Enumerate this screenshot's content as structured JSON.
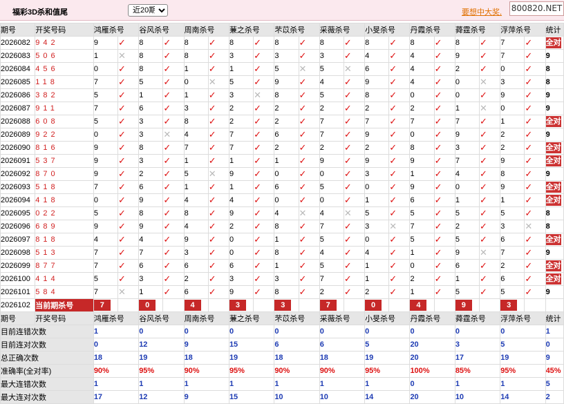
{
  "header": {
    "title": "福彩3D杀和值尾",
    "period_selected": "近20期",
    "period_options": [
      "近20期"
    ],
    "promo_link": "要想中大奖,",
    "site": "800820.NET"
  },
  "columns": {
    "issue": "期号",
    "draw": "开奖号码",
    "experts": [
      "鸿雁杀号",
      "谷风杀号",
      "周南杀号",
      "蒹之杀号",
      "芣苡杀号",
      "采薇杀号",
      "小旻杀号",
      "丹霞杀号",
      "蕣霆杀号",
      "浮萍杀号"
    ],
    "stats": "统计"
  },
  "rows": [
    {
      "issue": "2026082",
      "draw": "942",
      "v": [
        "9",
        "8",
        "8",
        "8",
        "8",
        "8",
        "8",
        "8",
        "8",
        "7"
      ],
      "m": [
        1,
        1,
        1,
        1,
        1,
        1,
        1,
        1,
        1,
        1
      ],
      "stat": "全对"
    },
    {
      "issue": "2026083",
      "draw": "506",
      "v": [
        "1",
        "8",
        "8",
        "3",
        "3",
        "3",
        "4",
        "4",
        "9",
        "7"
      ],
      "m": [
        0,
        1,
        1,
        1,
        1,
        1,
        1,
        1,
        1,
        1
      ],
      "stat": "9"
    },
    {
      "issue": "2026084",
      "draw": "456",
      "v": [
        "0",
        "8",
        "1",
        "1",
        "5",
        "5",
        "6",
        "4",
        "2",
        "0"
      ],
      "m": [
        1,
        1,
        1,
        1,
        0,
        0,
        1,
        1,
        1,
        1
      ],
      "stat": "8"
    },
    {
      "issue": "2026085",
      "draw": "118",
      "v": [
        "7",
        "5",
        "0",
        "5",
        "9",
        "4",
        "9",
        "4",
        "0",
        "3"
      ],
      "m": [
        1,
        1,
        0,
        1,
        1,
        1,
        1,
        1,
        0,
        1
      ],
      "stat": "8"
    },
    {
      "issue": "2026086",
      "draw": "382",
      "v": [
        "5",
        "1",
        "1",
        "3",
        "8",
        "5",
        "8",
        "0",
        "0",
        "9"
      ],
      "m": [
        1,
        1,
        1,
        0,
        1,
        1,
        1,
        1,
        1,
        1
      ],
      "stat": "9"
    },
    {
      "issue": "2026087",
      "draw": "911",
      "v": [
        "7",
        "6",
        "3",
        "2",
        "2",
        "2",
        "2",
        "2",
        "1",
        "0"
      ],
      "m": [
        1,
        1,
        1,
        1,
        1,
        1,
        1,
        1,
        0,
        1
      ],
      "stat": "9"
    },
    {
      "issue": "2026088",
      "draw": "608",
      "v": [
        "5",
        "3",
        "8",
        "2",
        "2",
        "7",
        "7",
        "7",
        "7",
        "1"
      ],
      "m": [
        1,
        1,
        1,
        1,
        1,
        1,
        1,
        1,
        1,
        1
      ],
      "stat": "全对"
    },
    {
      "issue": "2026089",
      "draw": "922",
      "v": [
        "0",
        "3",
        "4",
        "7",
        "6",
        "7",
        "9",
        "0",
        "9",
        "2"
      ],
      "m": [
        1,
        0,
        1,
        1,
        1,
        1,
        1,
        1,
        1,
        1
      ],
      "stat": "9"
    },
    {
      "issue": "2026090",
      "draw": "816",
      "v": [
        "9",
        "8",
        "7",
        "7",
        "2",
        "2",
        "2",
        "8",
        "3",
        "2"
      ],
      "m": [
        1,
        1,
        1,
        1,
        1,
        1,
        1,
        1,
        1,
        1
      ],
      "stat": "全对"
    },
    {
      "issue": "2026091",
      "draw": "537",
      "v": [
        "9",
        "3",
        "1",
        "1",
        "1",
        "9",
        "9",
        "9",
        "7",
        "9"
      ],
      "m": [
        1,
        1,
        1,
        1,
        1,
        1,
        1,
        1,
        1,
        1
      ],
      "stat": "全对"
    },
    {
      "issue": "2026092",
      "draw": "870",
      "v": [
        "9",
        "2",
        "5",
        "9",
        "0",
        "0",
        "3",
        "1",
        "4",
        "8"
      ],
      "m": [
        1,
        1,
        0,
        1,
        1,
        1,
        1,
        1,
        1,
        1
      ],
      "stat": "9"
    },
    {
      "issue": "2026093",
      "draw": "518",
      "v": [
        "7",
        "6",
        "1",
        "1",
        "6",
        "5",
        "0",
        "9",
        "0",
        "9"
      ],
      "m": [
        1,
        1,
        1,
        1,
        1,
        1,
        1,
        1,
        1,
        1
      ],
      "stat": "全对"
    },
    {
      "issue": "2026094",
      "draw": "418",
      "v": [
        "0",
        "9",
        "4",
        "4",
        "0",
        "0",
        "1",
        "6",
        "1",
        "1"
      ],
      "m": [
        1,
        1,
        1,
        1,
        1,
        1,
        1,
        1,
        1,
        1
      ],
      "stat": "全对"
    },
    {
      "issue": "2026095",
      "draw": "022",
      "v": [
        "5",
        "8",
        "8",
        "9",
        "4",
        "4",
        "5",
        "5",
        "5",
        "5"
      ],
      "m": [
        1,
        1,
        1,
        1,
        0,
        0,
        1,
        1,
        1,
        1
      ],
      "stat": "8"
    },
    {
      "issue": "2026096",
      "draw": "689",
      "v": [
        "9",
        "9",
        "4",
        "2",
        "8",
        "7",
        "3",
        "7",
        "2",
        "3"
      ],
      "m": [
        1,
        1,
        1,
        1,
        1,
        1,
        0,
        1,
        1,
        0
      ],
      "stat": "8"
    },
    {
      "issue": "2026097",
      "draw": "818",
      "v": [
        "4",
        "4",
        "9",
        "0",
        "1",
        "5",
        "0",
        "5",
        "5",
        "6"
      ],
      "m": [
        1,
        1,
        1,
        1,
        1,
        1,
        1,
        1,
        1,
        1
      ],
      "stat": "全对"
    },
    {
      "issue": "2026098",
      "draw": "513",
      "v": [
        "7",
        "7",
        "3",
        "0",
        "8",
        "4",
        "4",
        "1",
        "9",
        "7"
      ],
      "m": [
        1,
        1,
        1,
        1,
        1,
        1,
        1,
        1,
        0,
        1
      ],
      "stat": "9"
    },
    {
      "issue": "2026099",
      "draw": "877",
      "v": [
        "7",
        "6",
        "6",
        "6",
        "1",
        "5",
        "1",
        "0",
        "6",
        "2"
      ],
      "m": [
        1,
        1,
        1,
        1,
        1,
        1,
        1,
        1,
        1,
        1
      ],
      "stat": "全对"
    },
    {
      "issue": "2026100",
      "draw": "414",
      "v": [
        "5",
        "3",
        "2",
        "3",
        "3",
        "7",
        "1",
        "2",
        "1",
        "6"
      ],
      "m": [
        1,
        1,
        1,
        1,
        1,
        1,
        1,
        1,
        1,
        1
      ],
      "stat": "全对"
    },
    {
      "issue": "2026101",
      "draw": "584",
      "v": [
        "7",
        "1",
        "6",
        "9",
        "8",
        "2",
        "2",
        "1",
        "5",
        "5"
      ],
      "m": [
        0,
        1,
        1,
        1,
        1,
        1,
        1,
        1,
        1,
        1
      ],
      "stat": "9"
    }
  ],
  "current": {
    "issue": "2026102",
    "label": "当前期杀号",
    "values": [
      "7",
      "0",
      "4",
      "3",
      "3",
      "7",
      "0",
      "4",
      "9",
      "3"
    ]
  },
  "stats": [
    {
      "label": "目前连错次数",
      "color": "blue",
      "values": [
        "1",
        "0",
        "0",
        "0",
        "0",
        "0",
        "0",
        "0",
        "0",
        "0",
        "1"
      ]
    },
    {
      "label": "目前连对次数",
      "color": "blue",
      "values": [
        "0",
        "12",
        "9",
        "15",
        "6",
        "6",
        "5",
        "20",
        "3",
        "5",
        "0"
      ]
    },
    {
      "label": "总正确次数",
      "color": "blue",
      "values": [
        "18",
        "19",
        "18",
        "19",
        "18",
        "18",
        "19",
        "20",
        "17",
        "19",
        "9"
      ]
    },
    {
      "label": "准确率(全对率)",
      "color": "red",
      "values": [
        "90%",
        "95%",
        "90%",
        "95%",
        "90%",
        "90%",
        "95%",
        "100%",
        "85%",
        "95%",
        "45%"
      ]
    },
    {
      "label": "最大连错次数",
      "color": "blue",
      "values": [
        "1",
        "1",
        "1",
        "1",
        "1",
        "1",
        "1",
        "0",
        "1",
        "1",
        "5"
      ]
    },
    {
      "label": "最大连对次数",
      "color": "blue",
      "values": [
        "17",
        "12",
        "9",
        "15",
        "10",
        "10",
        "14",
        "20",
        "10",
        "14",
        "2"
      ]
    }
  ],
  "icons": {
    "correct": "check-mark-icon",
    "wrong": "cross-mark-icon"
  },
  "colors": {
    "accent": "#c62828",
    "draw_digits": "#d12020",
    "stat_blue": "#1d3bb3",
    "header_bg": "#fbe9ee"
  }
}
